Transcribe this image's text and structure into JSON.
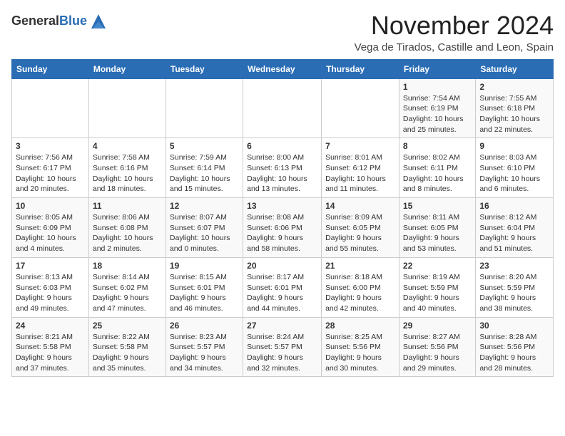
{
  "header": {
    "logo_general": "General",
    "logo_blue": "Blue",
    "month_title": "November 2024",
    "location": "Vega de Tirados, Castille and Leon, Spain"
  },
  "days_of_week": [
    "Sunday",
    "Monday",
    "Tuesday",
    "Wednesday",
    "Thursday",
    "Friday",
    "Saturday"
  ],
  "weeks": [
    [
      {
        "day": "",
        "info": ""
      },
      {
        "day": "",
        "info": ""
      },
      {
        "day": "",
        "info": ""
      },
      {
        "day": "",
        "info": ""
      },
      {
        "day": "",
        "info": ""
      },
      {
        "day": "1",
        "info": "Sunrise: 7:54 AM\nSunset: 6:19 PM\nDaylight: 10 hours and 25 minutes."
      },
      {
        "day": "2",
        "info": "Sunrise: 7:55 AM\nSunset: 6:18 PM\nDaylight: 10 hours and 22 minutes."
      }
    ],
    [
      {
        "day": "3",
        "info": "Sunrise: 7:56 AM\nSunset: 6:17 PM\nDaylight: 10 hours and 20 minutes."
      },
      {
        "day": "4",
        "info": "Sunrise: 7:58 AM\nSunset: 6:16 PM\nDaylight: 10 hours and 18 minutes."
      },
      {
        "day": "5",
        "info": "Sunrise: 7:59 AM\nSunset: 6:14 PM\nDaylight: 10 hours and 15 minutes."
      },
      {
        "day": "6",
        "info": "Sunrise: 8:00 AM\nSunset: 6:13 PM\nDaylight: 10 hours and 13 minutes."
      },
      {
        "day": "7",
        "info": "Sunrise: 8:01 AM\nSunset: 6:12 PM\nDaylight: 10 hours and 11 minutes."
      },
      {
        "day": "8",
        "info": "Sunrise: 8:02 AM\nSunset: 6:11 PM\nDaylight: 10 hours and 8 minutes."
      },
      {
        "day": "9",
        "info": "Sunrise: 8:03 AM\nSunset: 6:10 PM\nDaylight: 10 hours and 6 minutes."
      }
    ],
    [
      {
        "day": "10",
        "info": "Sunrise: 8:05 AM\nSunset: 6:09 PM\nDaylight: 10 hours and 4 minutes."
      },
      {
        "day": "11",
        "info": "Sunrise: 8:06 AM\nSunset: 6:08 PM\nDaylight: 10 hours and 2 minutes."
      },
      {
        "day": "12",
        "info": "Sunrise: 8:07 AM\nSunset: 6:07 PM\nDaylight: 10 hours and 0 minutes."
      },
      {
        "day": "13",
        "info": "Sunrise: 8:08 AM\nSunset: 6:06 PM\nDaylight: 9 hours and 58 minutes."
      },
      {
        "day": "14",
        "info": "Sunrise: 8:09 AM\nSunset: 6:05 PM\nDaylight: 9 hours and 55 minutes."
      },
      {
        "day": "15",
        "info": "Sunrise: 8:11 AM\nSunset: 6:05 PM\nDaylight: 9 hours and 53 minutes."
      },
      {
        "day": "16",
        "info": "Sunrise: 8:12 AM\nSunset: 6:04 PM\nDaylight: 9 hours and 51 minutes."
      }
    ],
    [
      {
        "day": "17",
        "info": "Sunrise: 8:13 AM\nSunset: 6:03 PM\nDaylight: 9 hours and 49 minutes."
      },
      {
        "day": "18",
        "info": "Sunrise: 8:14 AM\nSunset: 6:02 PM\nDaylight: 9 hours and 47 minutes."
      },
      {
        "day": "19",
        "info": "Sunrise: 8:15 AM\nSunset: 6:01 PM\nDaylight: 9 hours and 46 minutes."
      },
      {
        "day": "20",
        "info": "Sunrise: 8:17 AM\nSunset: 6:01 PM\nDaylight: 9 hours and 44 minutes."
      },
      {
        "day": "21",
        "info": "Sunrise: 8:18 AM\nSunset: 6:00 PM\nDaylight: 9 hours and 42 minutes."
      },
      {
        "day": "22",
        "info": "Sunrise: 8:19 AM\nSunset: 5:59 PM\nDaylight: 9 hours and 40 minutes."
      },
      {
        "day": "23",
        "info": "Sunrise: 8:20 AM\nSunset: 5:59 PM\nDaylight: 9 hours and 38 minutes."
      }
    ],
    [
      {
        "day": "24",
        "info": "Sunrise: 8:21 AM\nSunset: 5:58 PM\nDaylight: 9 hours and 37 minutes."
      },
      {
        "day": "25",
        "info": "Sunrise: 8:22 AM\nSunset: 5:58 PM\nDaylight: 9 hours and 35 minutes."
      },
      {
        "day": "26",
        "info": "Sunrise: 8:23 AM\nSunset: 5:57 PM\nDaylight: 9 hours and 34 minutes."
      },
      {
        "day": "27",
        "info": "Sunrise: 8:24 AM\nSunset: 5:57 PM\nDaylight: 9 hours and 32 minutes."
      },
      {
        "day": "28",
        "info": "Sunrise: 8:25 AM\nSunset: 5:56 PM\nDaylight: 9 hours and 30 minutes."
      },
      {
        "day": "29",
        "info": "Sunrise: 8:27 AM\nSunset: 5:56 PM\nDaylight: 9 hours and 29 minutes."
      },
      {
        "day": "30",
        "info": "Sunrise: 8:28 AM\nSunset: 5:56 PM\nDaylight: 9 hours and 28 minutes."
      }
    ]
  ]
}
